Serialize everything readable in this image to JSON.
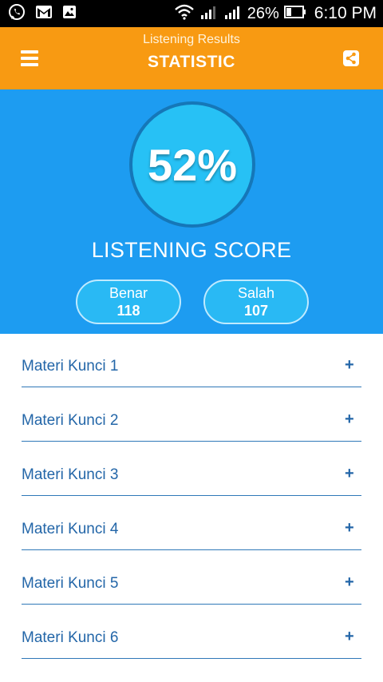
{
  "status_bar": {
    "battery": "26%",
    "time": "6:10 PM",
    "icons": [
      "whatsapp-icon",
      "gmail-icon",
      "image-icon",
      "wifi-icon",
      "signal-icon",
      "signal-icon",
      "battery-icon"
    ]
  },
  "app_bar": {
    "subtitle": "Listening Results",
    "title": "STATISTIC",
    "icons": [
      "menu-icon",
      "share-icon"
    ],
    "color": "#f89a12"
  },
  "score": {
    "value": "52%",
    "label": "LISTENING SCORE",
    "benar_label": "Benar",
    "benar_count": "118",
    "salah_label": "Salah",
    "salah_count": "107",
    "background_color": "#1d9cf1"
  },
  "list": {
    "items": [
      {
        "label": "Materi Kunci 1",
        "toggle": "+"
      },
      {
        "label": "Materi Kunci 2",
        "toggle": "+"
      },
      {
        "label": "Materi Kunci 3",
        "toggle": "+"
      },
      {
        "label": "Materi Kunci 4",
        "toggle": "+"
      },
      {
        "label": "Materi Kunci 5",
        "toggle": "+"
      },
      {
        "label": "Materi Kunci 6",
        "toggle": "+"
      }
    ]
  }
}
